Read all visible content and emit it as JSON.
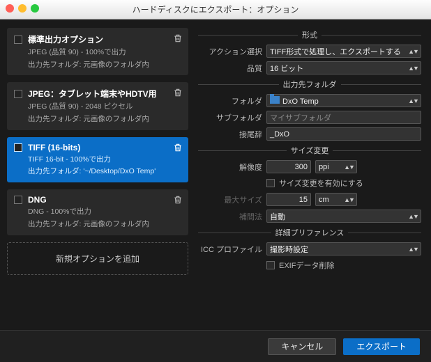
{
  "title": "ハードディスクにエクスポート：オプション",
  "left": {
    "items": [
      {
        "name": "標準出力オプション",
        "sub1": "JPEG (品質 90) - 100%で出力",
        "sub2": "出力先フォルダ: 元画像のフォルダ内",
        "selected": false
      },
      {
        "name": "JPEG：タブレット端末やHDTV用",
        "sub1": "JPEG (品質 90) - 2048 ピクセル",
        "sub2": "出力先フォルダ: 元画像のフォルダ内",
        "selected": false
      },
      {
        "name": "TIFF (16-bits)",
        "sub1": "TIFF 16-bit - 100%で出力",
        "sub2": "出力先フォルダ: '~/Desktop/DxO Temp'",
        "selected": true
      },
      {
        "name": "DNG",
        "sub1": "DNG - 100%で出力",
        "sub2": "出力先フォルダ: 元画像のフォルダ内",
        "selected": false
      }
    ],
    "add_label": "新規オプションを追加"
  },
  "right": {
    "section_format": "形式",
    "action_label": "アクション選択",
    "action_value": "TIFF形式で処理し、エクスポートする",
    "quality_label": "品質",
    "quality_value": "16 ビット",
    "section_dest": "出力先フォルダ",
    "folder_label": "フォルダ",
    "folder_value": "DxO Temp",
    "subfolder_label": "サブフォルダ",
    "subfolder_value": "マイサブフォルダ",
    "suffix_label": "接尾辞",
    "suffix_value": "_DxO",
    "section_resize": "サイズ変更",
    "resolution_label": "解像度",
    "resolution_value": "300",
    "resolution_unit": "ppi",
    "resize_enable": "サイズ変更を有効にする",
    "maxsize_label": "最大サイズ",
    "maxsize_value": "15",
    "maxsize_unit": "cm",
    "interp_label": "補間法",
    "interp_value": "自動",
    "section_pref": "詳細プリファレンス",
    "icc_label": "ICC プロファイル",
    "icc_value": "撮影時設定",
    "exif_delete": "EXIFデータ削除"
  },
  "footer": {
    "cancel": "キャンセル",
    "export": "エクスポート"
  }
}
